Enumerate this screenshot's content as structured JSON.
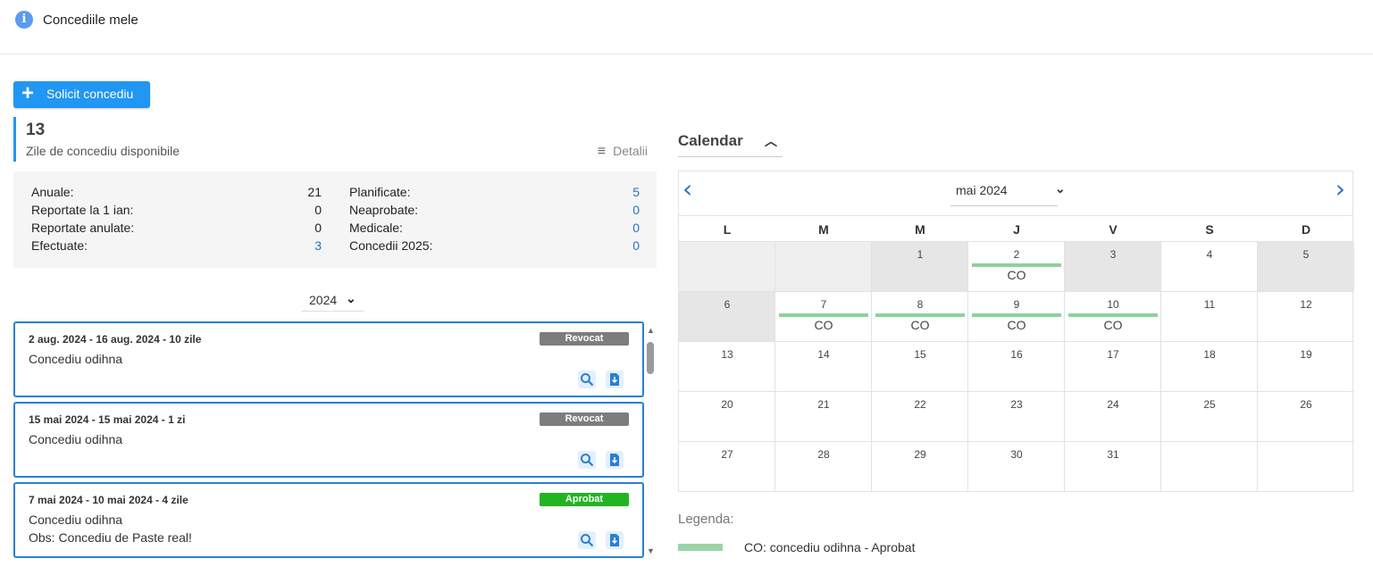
{
  "header": {
    "title": "Concediile mele"
  },
  "request_button": {
    "label": "Solicit concediu"
  },
  "available": {
    "count": "13",
    "label": "Zile de concediu disponibile",
    "details_label": "Detalii"
  },
  "stats_left": [
    {
      "label": "Anuale:",
      "value": "21"
    },
    {
      "label": "Reportate la 1 ian:",
      "value": "0"
    },
    {
      "label": "Reportate anulate:",
      "value": "0"
    },
    {
      "label": "Efectuate:",
      "value": "3"
    }
  ],
  "stats_right": [
    {
      "label": "Planificate:",
      "value": "5"
    },
    {
      "label": "Neaprobate:",
      "value": "0"
    },
    {
      "label": "Medicale:",
      "value": "0"
    },
    {
      "label": "Concedii 2025:",
      "value": "0"
    }
  ],
  "year_select": {
    "value": "2024"
  },
  "leaves": [
    {
      "title": "2 aug. 2024 - 16 aug. 2024 - 10 zile",
      "type": "Concediu odihna",
      "obs": "",
      "status": "Revocat"
    },
    {
      "title": "15 mai 2024 - 15 mai 2024 - 1 zi",
      "type": "Concediu odihna",
      "obs": "",
      "status": "Revocat"
    },
    {
      "title": "7 mai 2024 - 10 mai 2024 - 4 zile",
      "type": "Concediu odihna",
      "obs": "Obs: Concediu de Paste real!",
      "status": "Aprobat"
    }
  ],
  "calendar": {
    "title": "Calendar",
    "month": "mai 2024",
    "weekdays": [
      "L",
      "M",
      "M",
      "J",
      "V",
      "S",
      "D"
    ],
    "weeks": [
      [
        {
          "d": "",
          "g": "e"
        },
        {
          "d": "",
          "g": "e"
        },
        {
          "d": "1",
          "g": "g"
        },
        {
          "d": "2",
          "c": "CO"
        },
        {
          "d": "3",
          "g": "g"
        },
        {
          "d": "4"
        },
        {
          "d": "5",
          "g": "g"
        }
      ],
      [
        {
          "d": "6",
          "g": "g"
        },
        {
          "d": "7",
          "c": "CO"
        },
        {
          "d": "8",
          "c": "CO"
        },
        {
          "d": "9",
          "c": "CO"
        },
        {
          "d": "10",
          "c": "CO"
        },
        {
          "d": "11"
        },
        {
          "d": "12"
        }
      ],
      [
        {
          "d": "13"
        },
        {
          "d": "14"
        },
        {
          "d": "15"
        },
        {
          "d": "16"
        },
        {
          "d": "17"
        },
        {
          "d": "18"
        },
        {
          "d": "19"
        }
      ],
      [
        {
          "d": "20"
        },
        {
          "d": "21"
        },
        {
          "d": "22"
        },
        {
          "d": "23"
        },
        {
          "d": "24"
        },
        {
          "d": "25"
        },
        {
          "d": "26"
        }
      ],
      [
        {
          "d": "27"
        },
        {
          "d": "28"
        },
        {
          "d": "29"
        },
        {
          "d": "30"
        },
        {
          "d": "31"
        },
        {
          "d": ""
        },
        {
          "d": ""
        }
      ]
    ]
  },
  "legend": {
    "title": "Legenda:",
    "item": "CO: concediu odihna - Aprobat",
    "color": "#9ad4a8"
  },
  "colors": {
    "accent": "#2196f3",
    "revocat": "#7d7d7d",
    "aprobat": "#22b422"
  }
}
